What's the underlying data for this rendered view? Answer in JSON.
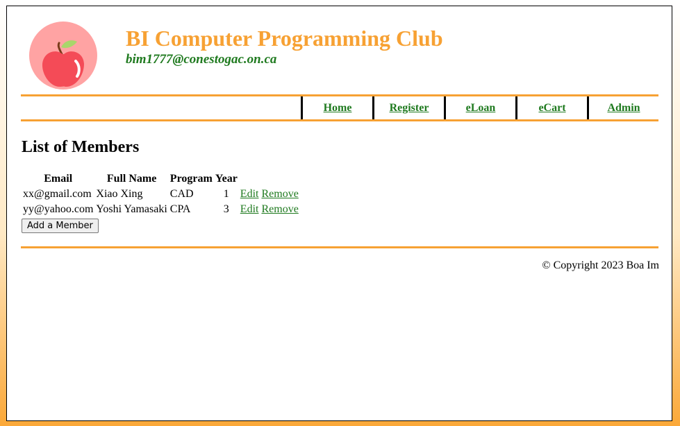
{
  "header": {
    "title": "BI Computer Programming Club",
    "email": "bim1777@conestogac.on.ca",
    "logo_icon": "apple-icon"
  },
  "nav": {
    "items": [
      {
        "label": "Home"
      },
      {
        "label": "Register"
      },
      {
        "label": "eLoan"
      },
      {
        "label": "eCart"
      },
      {
        "label": "Admin"
      }
    ]
  },
  "main": {
    "heading": "List of Members",
    "table": {
      "columns": [
        "Email",
        "Full Name",
        "Program",
        "Year"
      ],
      "rows": [
        {
          "email": "xx@gmail.com",
          "full_name": "Xiao Xing",
          "program": "CAD",
          "year": "1",
          "edit_label": "Edit",
          "remove_label": "Remove"
        },
        {
          "email": "yy@yahoo.com",
          "full_name": "Yoshi Yamasaki",
          "program": "CPA",
          "year": "3",
          "edit_label": "Edit",
          "remove_label": "Remove"
        }
      ]
    },
    "add_button_label": "Add a Member"
  },
  "footer": {
    "copyright": "© Copyright 2023 Boa Im"
  },
  "colors": {
    "accent_orange": "#f7a133",
    "link_green": "#1f7a1f",
    "apple_red": "#f44b57",
    "logo_circle": "#ffa3a3"
  }
}
